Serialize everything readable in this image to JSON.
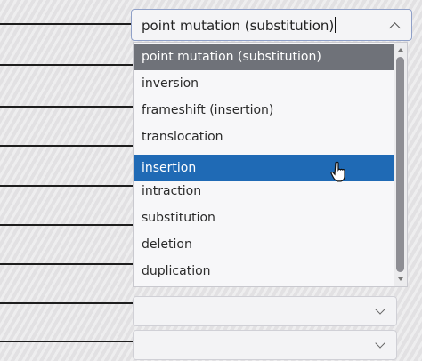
{
  "select": {
    "current_value": "point mutation (substitution)"
  },
  "options": [
    {
      "label": "point mutation (substitution)",
      "state": "selected"
    },
    {
      "label": "inversion",
      "state": "normal"
    },
    {
      "label": "frameshift (insertion)",
      "state": "normal"
    },
    {
      "label": "translocation",
      "state": "normal"
    },
    {
      "label": "insertion",
      "state": "hover"
    },
    {
      "label": "intraction",
      "state": "normal"
    },
    {
      "label": "substitution",
      "state": "normal"
    },
    {
      "label": "deletion",
      "state": "normal"
    },
    {
      "label": "duplication",
      "state": "normal"
    }
  ],
  "colors": {
    "selected_option": "#6f7279",
    "hover_option": "#1f6ab5",
    "select_border": "#8fa0c8"
  },
  "icons": {
    "select_toggle": "chevron-up-icon",
    "closed_select_toggle": "chevron-down-icon",
    "pointer": "hand-pointer-icon"
  }
}
